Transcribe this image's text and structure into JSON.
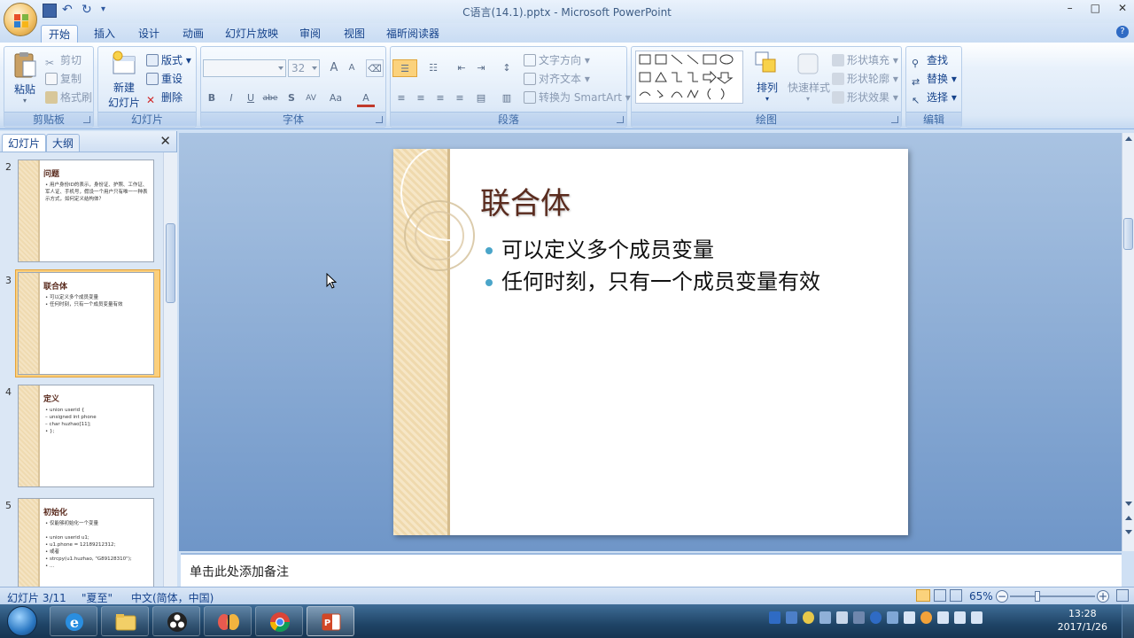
{
  "window": {
    "title": "C语言(14.1).pptx - Microsoft PowerPoint",
    "minimize": "–",
    "maximize": "□",
    "close": "✕"
  },
  "tabs": [
    "开始",
    "插入",
    "设计",
    "动画",
    "幻灯片放映",
    "审阅",
    "视图",
    "福昕阅读器"
  ],
  "ribbon": {
    "clipboard": {
      "label": "剪贴板",
      "paste": "粘贴",
      "cut": "剪切",
      "copy": "复制",
      "format_painter": "格式刷"
    },
    "slides": {
      "label": "幻灯片",
      "new_slide_line1": "新建",
      "new_slide_line2": "幻灯片",
      "layout": "版式",
      "reset": "重设",
      "delete": "删除"
    },
    "font": {
      "label": "字体",
      "font_name": "",
      "font_size": "32",
      "bold": "B",
      "italic": "I",
      "underline": "U",
      "strike": "abe",
      "shadow": "S",
      "spacing": "AV",
      "case": "Aa",
      "color": "A",
      "grow": "A",
      "shrink": "A"
    },
    "paragraph": {
      "label": "段落",
      "text_direction": "文字方向",
      "align_text": "对齐文本",
      "smartart": "转换为 SmartArt"
    },
    "drawing": {
      "label": "绘图",
      "arrange": "排列",
      "quick_styles": "快速样式",
      "shape_fill": "形状填充",
      "shape_outline": "形状轮廓",
      "shape_effects": "形状效果"
    },
    "editing": {
      "label": "编辑",
      "find": "查找",
      "replace": "替换",
      "select": "选择"
    }
  },
  "left_pane": {
    "tab_slides": "幻灯片",
    "tab_outline": "大纲",
    "close": "✕",
    "thumbnails": [
      {
        "num": "2",
        "title": "问题",
        "body": "• 用户身份ID的表示，身份证、护照、工作证、军人证、手机号，假设一个用户只有唯一一种表示方式，如何定义结构体？"
      },
      {
        "num": "3",
        "title": "联合体",
        "body": "• 可以定义多个成员变量\n• 任何时刻，只有一个成员变量有效"
      },
      {
        "num": "4",
        "title": "定义",
        "body": "• union userid {\n   – unsigned int phone\n   – char huzhao[11];\n• };"
      },
      {
        "num": "5",
        "title": "初始化",
        "body": "• 仅能够初始化一个变量\n\n• union userid u1;\n• u1.phone = 12189212312;\n• 或者\n• strcpy(u1.huzhao, \"G89128310\");\n• ..."
      }
    ]
  },
  "slide": {
    "title": "联合体",
    "bullets": [
      "可以定义多个成员变量",
      "任何时刻，只有一个成员变量有效"
    ]
  },
  "notes": {
    "placeholder": "单击此处添加备注"
  },
  "status": {
    "slide_info": "幻灯片 3/11",
    "theme": "\"夏至\"",
    "language": "中文(简体，中国)",
    "zoom": "65%",
    "zoom_out": "−",
    "zoom_in": "+"
  },
  "taskbar": {
    "apps": [
      "start",
      "internet-explorer",
      "file-explorer",
      "obs",
      "app-butterfly",
      "chrome",
      "powerpoint"
    ],
    "time": "13:28",
    "date": "2017/1/26"
  },
  "colors": {
    "ribbon_text": "#15428b",
    "slide_title": "#5a2b1e",
    "bullet": "#4aa5c9",
    "active_thumb": "#fbcf7c"
  }
}
